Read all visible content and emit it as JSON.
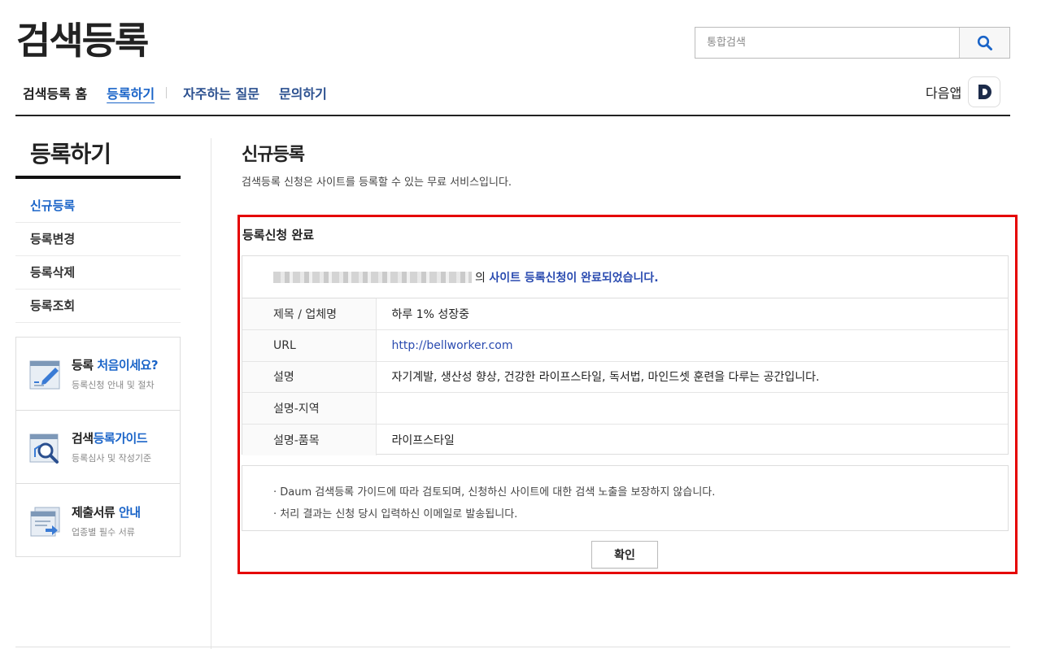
{
  "header": {
    "logo": "검색등록",
    "search_placeholder": "통합검색",
    "daum_app_label": "다음앱",
    "daum_badge": "D"
  },
  "gnb": {
    "home": "검색등록 홈",
    "register": "등록하기",
    "faq": "자주하는 질문",
    "contact": "문의하기"
  },
  "sidebar": {
    "title": "등록하기",
    "items": [
      {
        "label": "신규등록",
        "active": true
      },
      {
        "label": "등록변경",
        "active": false
      },
      {
        "label": "등록삭제",
        "active": false
      },
      {
        "label": "등록조회",
        "active": false
      }
    ],
    "banners": [
      {
        "title_a": "등록 ",
        "title_b": "처음이세요?",
        "sub": "등록신청 안내 및 절차",
        "icon": "pencil-form-icon"
      },
      {
        "title_a": "검색",
        "title_b": "등록가이드",
        "sub": "등록심사 및 작성기준",
        "icon": "magnifier-guide-icon"
      },
      {
        "title_a": "제출서류 ",
        "title_b": "안내",
        "sub": "업종별 필수 서류",
        "icon": "documents-icon"
      }
    ]
  },
  "main": {
    "title": "신규등록",
    "description": "검색등록 신청은 사이트를 등록할 수 있는 무료 서비스입니다.",
    "card_title": "등록신청 완료",
    "complete_suffix": "의",
    "complete_message": "사이트 등록신청이 완료되었습니다.",
    "rows": [
      {
        "label": "제목 / 업체명",
        "value": "하루 1% 성장중"
      },
      {
        "label": "URL",
        "value": "http://bellworker.com"
      },
      {
        "label": "설명",
        "value": "자기계발, 생산성 향상, 건강한 라이프스타일, 독서법, 마인드셋 훈련을 다루는 공간입니다."
      },
      {
        "label": "설명-지역",
        "value": ""
      },
      {
        "label": "설명-품목",
        "value": "라이프스타일"
      }
    ],
    "notices": [
      "· Daum 검색등록 가이드에 따라 검토되며, 신청하신 사이트에 대한 검색 노출을 보장하지 않습니다.",
      "· 처리 결과는 신청 당시 입력하신 이메일로 발송됩니다."
    ],
    "confirm_button": "확인"
  },
  "colors": {
    "accent_blue": "#1a64c8",
    "link_blue": "#2a4bb0",
    "highlight_red": "#e50000"
  }
}
